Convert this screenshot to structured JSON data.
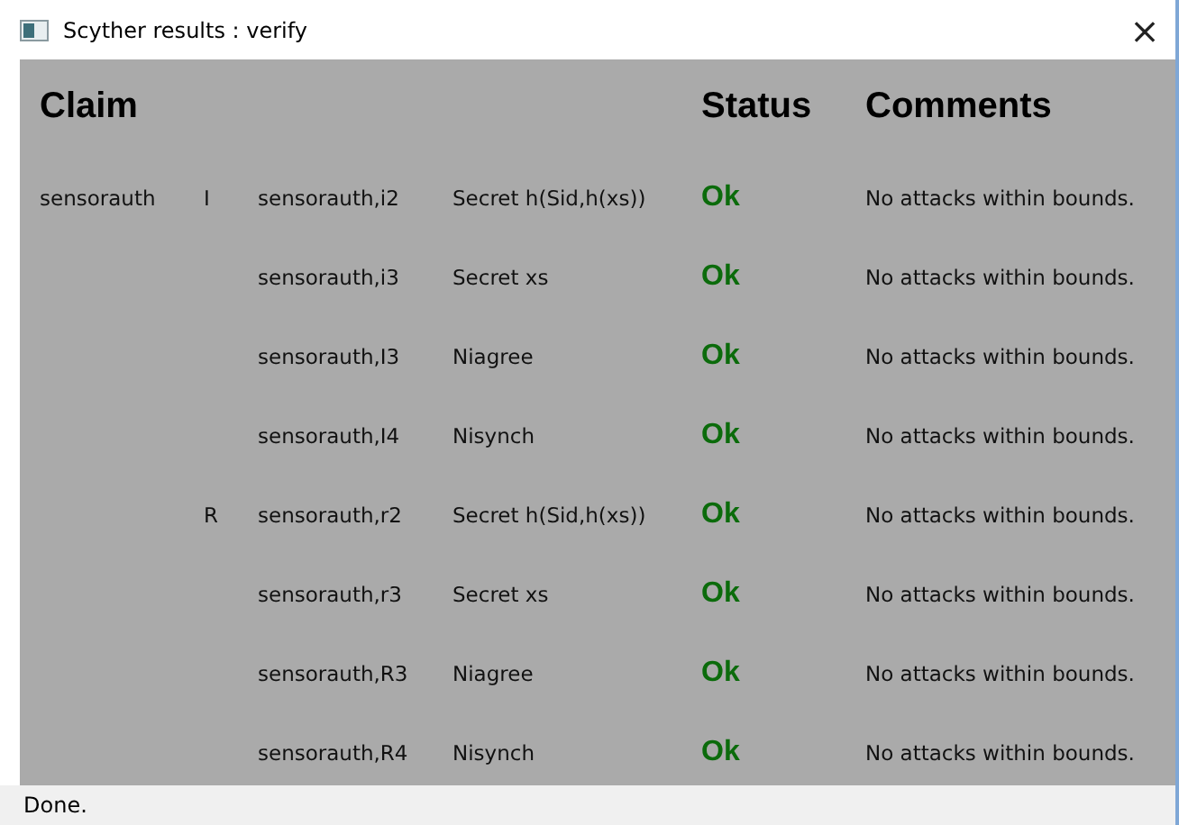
{
  "window": {
    "title": "Scyther results : verify",
    "close": "×"
  },
  "table": {
    "columns": [
      "Claim",
      "Status",
      "Comments"
    ],
    "rows": [
      {
        "protocol": "sensorauth",
        "role": "I",
        "claim_id": "sensorauth,i2",
        "claim": "Secret h(Sid,h(xs))",
        "status": "Ok",
        "comment": "No attacks within bounds."
      },
      {
        "claim_id": "sensorauth,i3",
        "claim": "Secret xs",
        "status": "Ok",
        "comment": "No attacks within bounds."
      },
      {
        "claim_id": "sensorauth,I3",
        "claim": "Niagree",
        "status": "Ok",
        "comment": "No attacks within bounds."
      },
      {
        "claim_id": "sensorauth,I4",
        "claim": "Nisynch",
        "status": "Ok",
        "comment": "No attacks within bounds."
      },
      {
        "role": "R",
        "claim_id": "sensorauth,r2",
        "claim": "Secret h(Sid,h(xs))",
        "status": "Ok",
        "comment": "No attacks within bounds."
      },
      {
        "claim_id": "sensorauth,r3",
        "claim": "Secret xs",
        "status": "Ok",
        "comment": "No attacks within bounds."
      },
      {
        "claim_id": "sensorauth,R3",
        "claim": "Niagree",
        "status": "Ok",
        "comment": "No attacks within bounds."
      },
      {
        "claim_id": "sensorauth,R4",
        "claim": "Nisynch",
        "status": "Ok",
        "comment": "No attacks within bounds."
      }
    ]
  },
  "status_bar": "Done."
}
